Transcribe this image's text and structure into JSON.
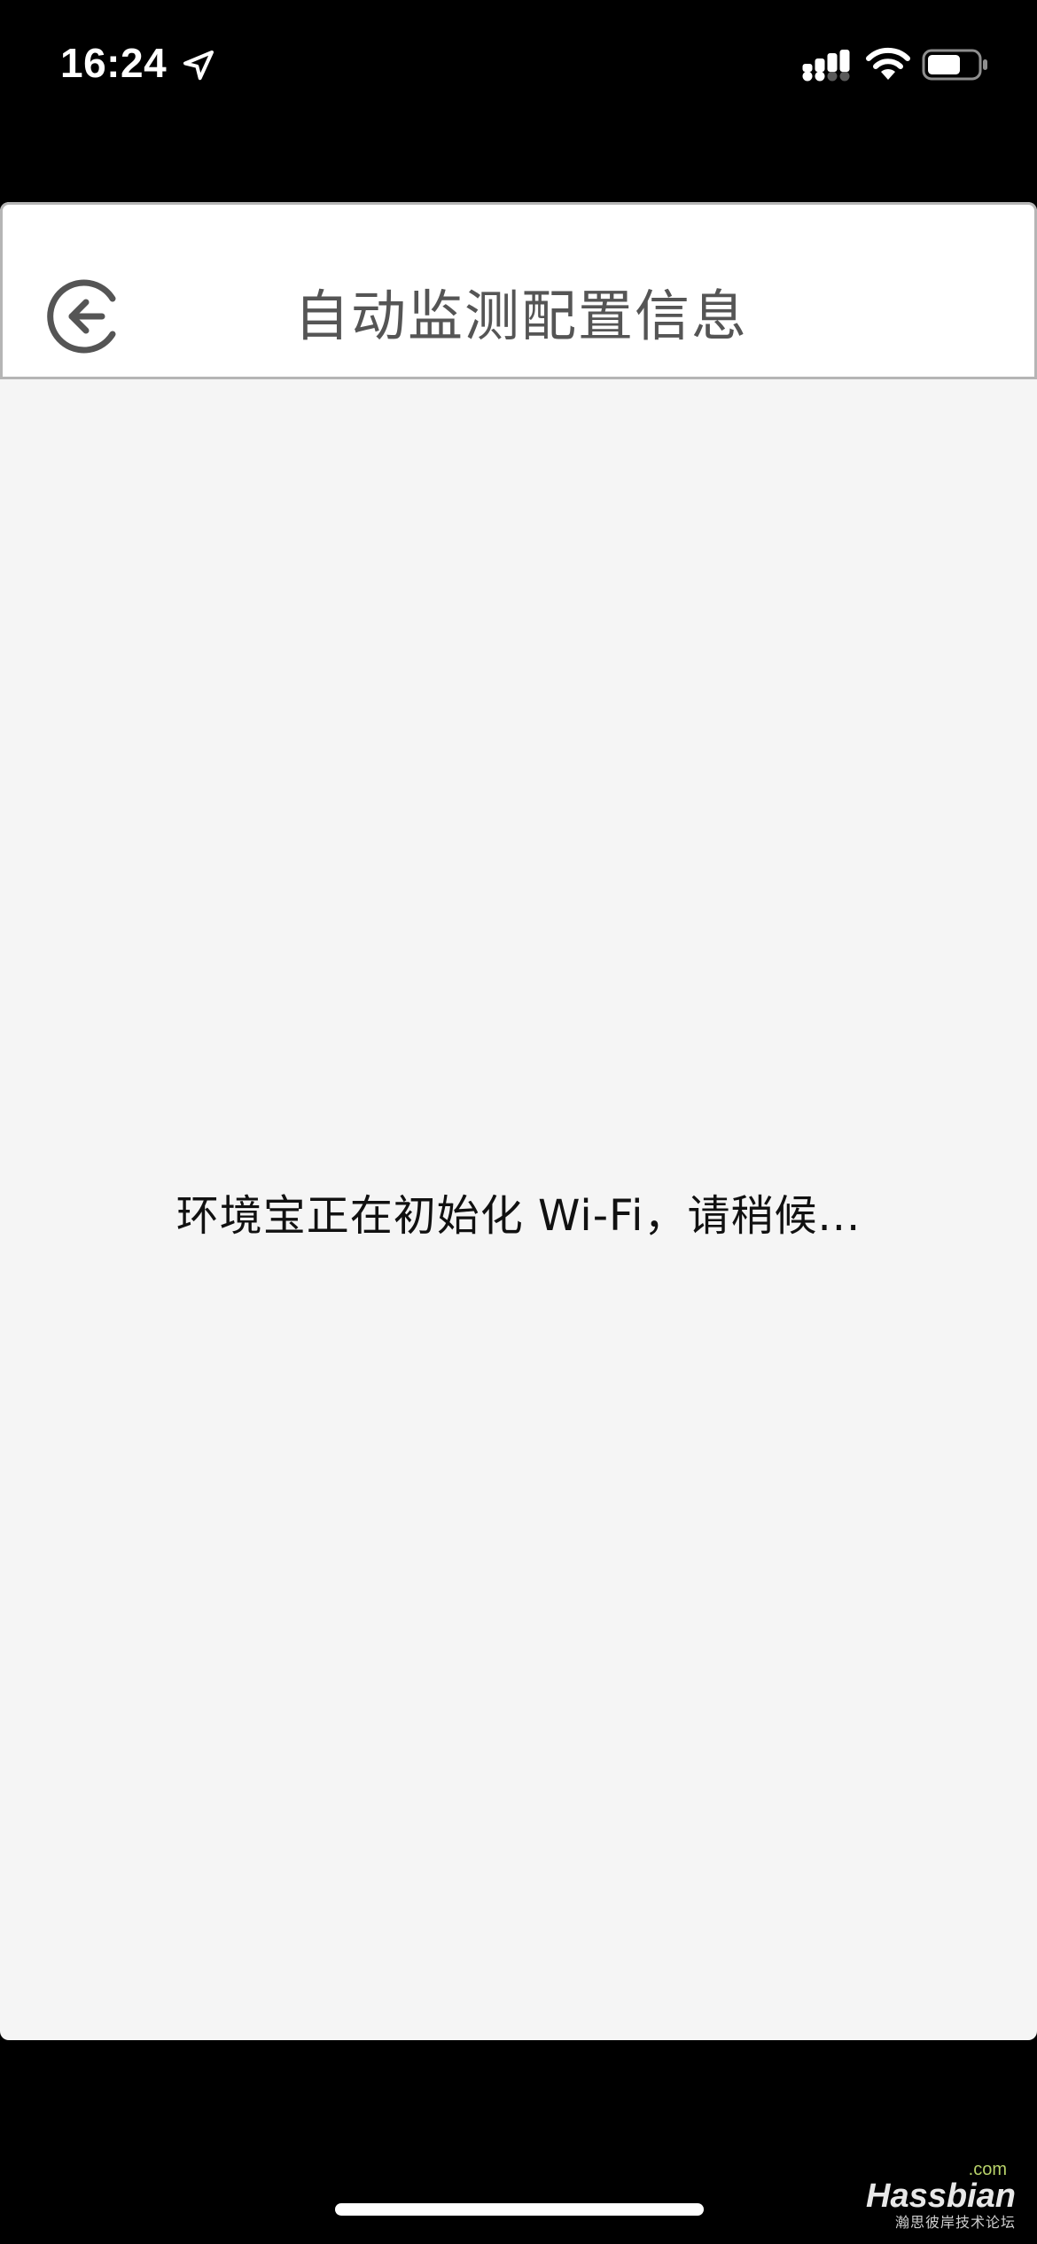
{
  "status_bar": {
    "time": "16:24",
    "icons": [
      "location-arrow-icon",
      "cellular-signal-icon",
      "wifi-icon",
      "battery-icon"
    ]
  },
  "nav": {
    "back_icon": "back-arrow-circle-icon",
    "title": "自动监测配置信息"
  },
  "content": {
    "message": "环境宝正在初始化 Wi-Fi，请稍候..."
  },
  "watermark": {
    "domain_suffix": ".com",
    "brand": "Hassbian",
    "subtitle": "瀚思彼岸技术论坛"
  },
  "colors": {
    "background": "#f5f5f5",
    "nav_background": "#ffffff",
    "nav_border": "#b5b5b5",
    "title_text": "#555555",
    "body_text": "#111111",
    "system_bar": "#000000"
  }
}
